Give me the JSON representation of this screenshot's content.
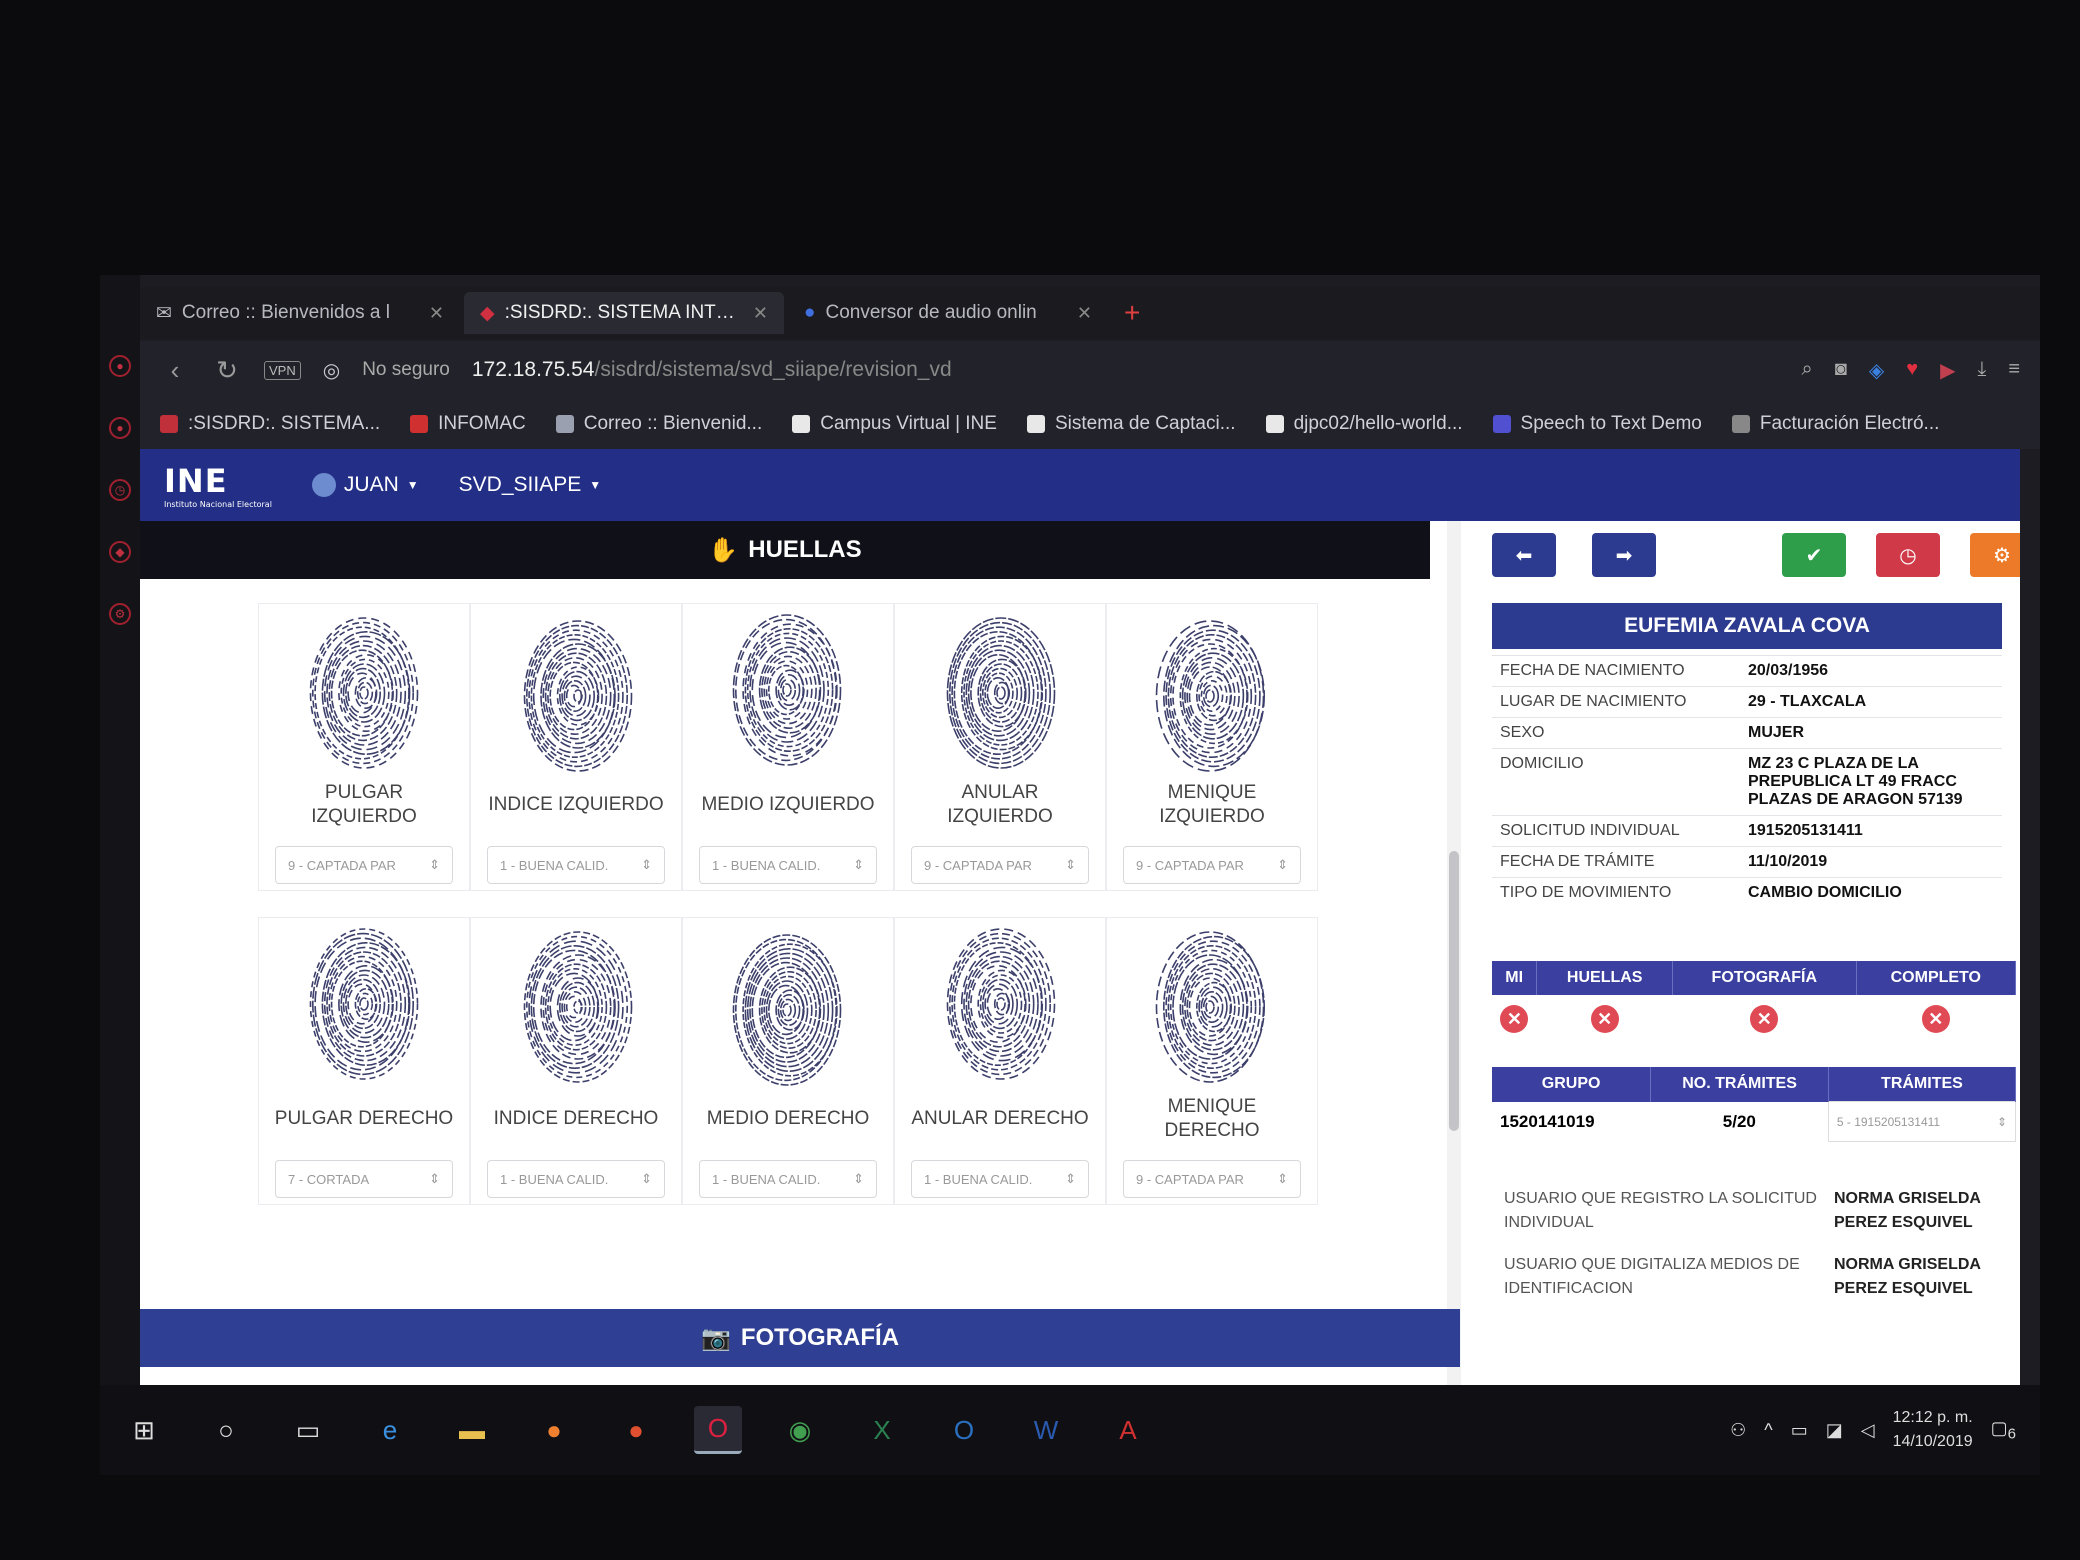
{
  "browser": {
    "tabs": [
      {
        "title": "Correo :: Bienvenidos a l"
      },
      {
        "title": ":SISDRD:. SISTEMA INTEG"
      },
      {
        "title": "Conversor de audio onlin"
      }
    ],
    "address": {
      "vpn_label": "VPN",
      "security_text": "No seguro",
      "host": "172.18.75.54",
      "path": "/sisdrd/sistema/svd_siiape/revision_vd"
    },
    "bookmarks": [
      {
        "label": ":SISDRD:. SISTEMA...",
        "color": "#c0303a"
      },
      {
        "label": "INFOMAC",
        "color": "#d03030"
      },
      {
        "label": "Correo :: Bienvenid...",
        "color": "#9aa0b0"
      },
      {
        "label": "Campus Virtual | INE",
        "color": "#e8e8e8"
      },
      {
        "label": "Sistema de Captaci...",
        "color": "#e8e8e8"
      },
      {
        "label": "djpc02/hello-world...",
        "color": "#e8e8e8"
      },
      {
        "label": "Speech to Text Demo",
        "color": "#5050d0"
      },
      {
        "label": "Facturación Electró...",
        "color": "#888888"
      }
    ]
  },
  "ine_nav": {
    "logo": "INE",
    "logo_sub": "Instituto Nacional Electoral",
    "user": "JUAN",
    "module": "SVD_SIIAPE"
  },
  "huellas": {
    "header": "HUELLAS",
    "rows": [
      [
        {
          "label": "PULGAR IZQUIERDO",
          "quality": "9 - CAPTADA PAR"
        },
        {
          "label": "INDICE IZQUIERDO",
          "quality": "1 - BUENA CALID."
        },
        {
          "label": "MEDIO IZQUIERDO",
          "quality": "1 - BUENA CALID."
        },
        {
          "label": "ANULAR IZQUIERDO",
          "quality": "9 - CAPTADA PAR"
        },
        {
          "label": "MENIQUE IZQUIERDO",
          "quality": "9 - CAPTADA PAR"
        }
      ],
      [
        {
          "label": "PULGAR DERECHO",
          "quality": "7 - CORTADA"
        },
        {
          "label": "INDICE DERECHO",
          "quality": "1 - BUENA CALID."
        },
        {
          "label": "MEDIO DERECHO",
          "quality": "1 - BUENA CALID."
        },
        {
          "label": "ANULAR DERECHO",
          "quality": "1 - BUENA CALID."
        },
        {
          "label": "MENIQUE DERECHO",
          "quality": "9 - CAPTADA PAR"
        }
      ]
    ]
  },
  "fotografia": {
    "header": "FOTOGRAFÍA"
  },
  "toolbar": {
    "colors": {
      "prev": "#2c3a8f",
      "next": "#2c3a8f",
      "approve": "#2e9e4a",
      "pending": "#d03a48",
      "settings": "#ec7a28"
    }
  },
  "person": {
    "name": "EUFEMIA ZAVALA COVA",
    "fields": [
      {
        "key": "FECHA DE NACIMIENTO",
        "value": "20/03/1956"
      },
      {
        "key": "LUGAR DE NACIMIENTO",
        "value": "29 - TLAXCALA"
      },
      {
        "key": "SEXO",
        "value": "MUJER"
      },
      {
        "key": "DOMICILIO",
        "value": "MZ 23 C PLAZA DE LA PREPUBLICA LT 49 FRACC PLAZAS DE ARAGON 57139"
      },
      {
        "key": "SOLICITUD INDIVIDUAL",
        "value": "1915205131411"
      },
      {
        "key": "FECHA DE TRÁMITE",
        "value": "11/10/2019"
      },
      {
        "key": "TIPO DE MOVIMIENTO",
        "value": "CAMBIO DOMICILIO"
      }
    ]
  },
  "status": {
    "headers": [
      "MI",
      "HUELLAS",
      "FOTOGRAFÍA",
      "COMPLETO"
    ]
  },
  "group": {
    "headers": [
      "GRUPO",
      "NO. TRÁMITES",
      "TRÁMITES"
    ],
    "grupo": "1520141019",
    "no_tramites": "5/20",
    "tramites_selected": "5 - 1915205131411"
  },
  "users": [
    {
      "key": "USUARIO QUE REGISTRO LA SOLICITUD INDIVIDUAL",
      "value": "NORMA GRISELDA PEREZ ESQUIVEL"
    },
    {
      "key": "USUARIO QUE DIGITALIZA MEDIOS DE IDENTIFICACION",
      "value": "NORMA GRISELDA PEREZ ESQUIVEL"
    }
  ],
  "taskbar": {
    "time": "12:12 p. m.",
    "date": "14/10/2019",
    "notifications": "6"
  }
}
